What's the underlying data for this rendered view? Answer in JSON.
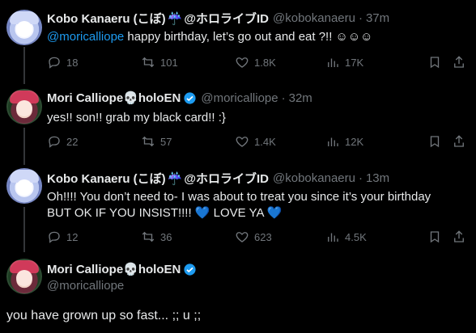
{
  "tweets": [
    {
      "name": "Kobo Kanaeru (こぼ)",
      "emoji": "☔",
      "name_suffix": "@ホロライブID",
      "handle": "@kobokanaeru",
      "time": "37m",
      "mention": "@moricalliope",
      "text": " happy birthday, let’s go out and eat ?!! ☺☺☺",
      "replies": "18",
      "retweets": "101",
      "likes": "1.8K",
      "views": "17K"
    },
    {
      "name": "Mori Calliope💀holoEN",
      "handle": "@moricalliope",
      "time": "32m",
      "text": "yes!! son!! grab my black card!! :}",
      "replies": "22",
      "retweets": "57",
      "likes": "1.4K",
      "views": "12K"
    },
    {
      "name": "Kobo Kanaeru (こぼ)",
      "emoji": "☔",
      "name_suffix": "@ホロライブID",
      "handle": "@kobokanaeru",
      "time": "13m",
      "line1": "Oh!!!! You don’t need to- I was about to treat you since it’s your birthday",
      "line2": "BUT OK IF YOU INSIST!!!! ",
      "heart1": "💙",
      "line2b": " LOVE YA ",
      "heart2": "💙",
      "replies": "12",
      "retweets": "36",
      "likes": "623",
      "views": "4.5K"
    }
  ],
  "focus": {
    "name": "Mori Calliope💀holoEN",
    "handle": "@moricalliope",
    "text": "you have grown up so fast... ;; u ;;"
  },
  "dot": "·",
  "colors": {
    "background": "#000000",
    "accent": "#1d9bf0",
    "muted": "#71767b",
    "text": "#e7e9ea"
  }
}
